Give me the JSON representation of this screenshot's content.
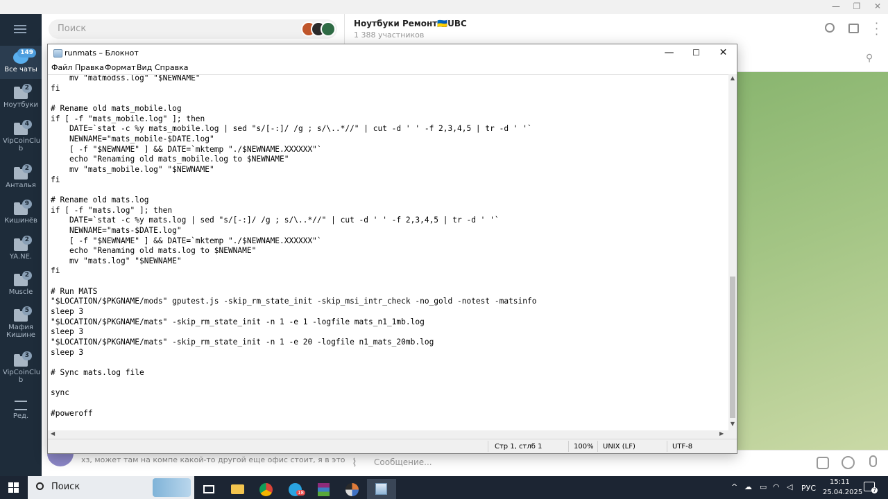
{
  "telegram": {
    "search_placeholder": "Поиск",
    "chat_title": "Ноутбуки Ремонт🇺🇦UBC",
    "chat_subtitle": "1 388 участников",
    "preview_text": "хз, может там на компе какой-то другой еще офис стоит, я в этой вин...",
    "compose_placeholder": "Сообщение...",
    "folders": [
      {
        "label": "Все чаты",
        "badge": "149"
      },
      {
        "label": "Ноутбуки",
        "badge": "2"
      },
      {
        "label": "VipCoinClu b",
        "badge": "4"
      },
      {
        "label": "Анталья",
        "badge": "2"
      },
      {
        "label": "Кишинёв",
        "badge": "9"
      },
      {
        "label": "YA.NE.",
        "badge": "2"
      },
      {
        "label": "Muscle",
        "badge": "2"
      },
      {
        "label": "Мафия Кишине",
        "badge": "5"
      },
      {
        "label": "VipCoinClu b",
        "badge": "3"
      },
      {
        "label": "Ред.",
        "badge": ""
      }
    ]
  },
  "notepad": {
    "title": "runmats – Блокнот",
    "menu": [
      "Файл",
      "Правка",
      "Формат",
      "Вид",
      "Справка"
    ],
    "content": "    mv \"matmodss.log\" \"$NEWNAME\"\nfi\n\n# Rename old mats_mobile.log\nif [ -f \"mats_mobile.log\" ]; then\n    DATE=`stat -c %y mats_mobile.log | sed \"s/[-:]/ /g ; s/\\..*//\" | cut -d ' ' -f 2,3,4,5 | tr -d ' '`\n    NEWNAME=\"mats_mobile-$DATE.log\"\n    [ -f \"$NEWNAME\" ] && DATE=`mktemp \"./$NEWNAME.XXXXXX\"`\n    echo \"Renaming old mats_mobile.log to $NEWNAME\"\n    mv \"mats_mobile.log\" \"$NEWNAME\"\nfi\n\n# Rename old mats.log\nif [ -f \"mats.log\" ]; then\n    DATE=`stat -c %y mats.log | sed \"s/[-:]/ /g ; s/\\..*//\" | cut -d ' ' -f 2,3,4,5 | tr -d ' '`\n    NEWNAME=\"mats-$DATE.log\"\n    [ -f \"$NEWNAME\" ] && DATE=`mktemp \"./$NEWNAME.XXXXXX\"`\n    echo \"Renaming old mats.log to $NEWNAME\"\n    mv \"mats.log\" \"$NEWNAME\"\nfi\n\n# Run MATS\n\"$LOCATION/$PKGNAME/mods\" gputest.js -skip_rm_state_init -skip_msi_intr_check -no_gold -notest -matsinfo\nsleep 3\n\"$LOCATION/$PKGNAME/mats\" -skip_rm_state_init -n 1 -e 1 -logfile mats_n1_1mb.log\nsleep 3\n\"$LOCATION/$PKGNAME/mats\" -skip_rm_state_init -n 1 -e 20 -logfile n1_mats_20mb.log\nsleep 3\n\n# Sync mats.log file\n\nsync\n\n#poweroff",
    "status": {
      "position": "Стр 1, стлб 1",
      "zoom": "100%",
      "line_ending": "UNIX (LF)",
      "encoding": "UTF-8"
    }
  },
  "taskbar": {
    "search_label": "Поиск",
    "telegram_badge": "18",
    "language": "РУС",
    "time": "15:11",
    "date": "25.04.2025",
    "notification_count": "7"
  },
  "colors": {
    "telegram_sidebar": "#1e2c3a",
    "telegram_accent": "#4e9ede",
    "taskbar": "#1c2533"
  }
}
